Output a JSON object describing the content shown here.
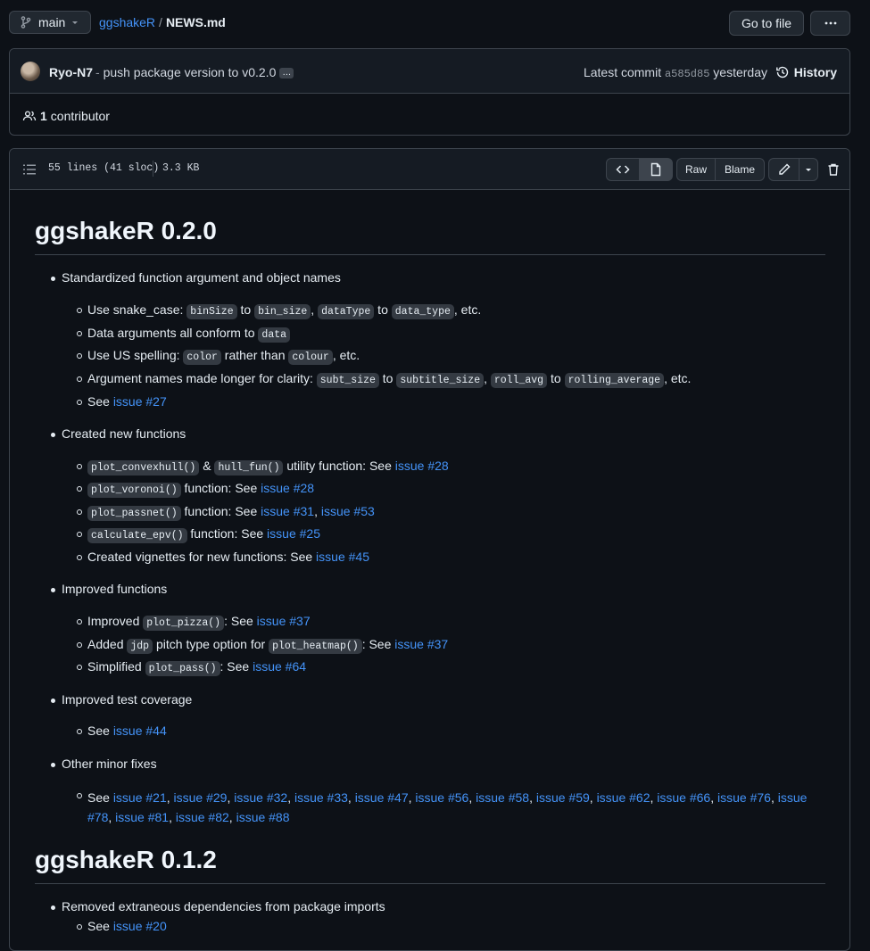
{
  "topbar": {
    "branch": "main",
    "repo": "ggshakeR",
    "separator": "/",
    "file": "NEWS.md",
    "go_to_file": "Go to file"
  },
  "commit": {
    "author": "Ryo-N7",
    "message_prefix": "-",
    "message": "push package version to v0.2.0",
    "ellipsis": "…",
    "latest_label": "Latest commit",
    "sha": "a585d85",
    "when": "yesterday",
    "history": "History",
    "contributors_count": "1",
    "contributors_label": "contributor"
  },
  "file": {
    "lines": "55 lines (41 sloc)",
    "size": "3.3 KB",
    "raw": "Raw",
    "blame": "Blame"
  },
  "doc": {
    "h1_a": "ggshakeR 0.2.0",
    "s1": {
      "title": "Standardized function argument and object names",
      "i1": {
        "t1": "Use snake_case: ",
        "c1": "binSize",
        "t2": " to ",
        "c2": "bin_size",
        "t3": ", ",
        "c3": "dataType",
        "t4": " to ",
        "c4": "data_type",
        "t5": ", etc."
      },
      "i2": {
        "t1": "Data arguments all conform to ",
        "c1": "data"
      },
      "i3": {
        "t1": "Use US spelling: ",
        "c1": "color",
        "t2": " rather than ",
        "c2": "colour",
        "t3": ", etc."
      },
      "i4": {
        "t1": "Argument names made longer for clarity: ",
        "c1": "subt_size",
        "t2": " to ",
        "c2": "subtitle_size",
        "t3": ", ",
        "c3": "roll_avg",
        "t4": " to ",
        "c4": "rolling_average",
        "t5": ", etc."
      },
      "i5": {
        "t1": "See ",
        "l1": "issue #27"
      }
    },
    "s2": {
      "title": "Created new functions",
      "i1": {
        "c1": "plot_convexhull()",
        "t1": " & ",
        "c2": "hull_fun()",
        "t2": " utility function: See ",
        "l1": "issue #28"
      },
      "i2": {
        "c1": "plot_voronoi()",
        "t1": " function: See ",
        "l1": "issue #28"
      },
      "i3": {
        "c1": "plot_passnet()",
        "t1": " function: See ",
        "l1": "issue #31",
        "t2": ", ",
        "l2": "issue #53"
      },
      "i4": {
        "c1": "calculate_epv()",
        "t1": " function: See ",
        "l1": "issue #25"
      },
      "i5": {
        "t1": "Created vignettes for new functions: See ",
        "l1": "issue #45"
      }
    },
    "s3": {
      "title": "Improved functions",
      "i1": {
        "t1": "Improved ",
        "c1": "plot_pizza()",
        "t2": ": See ",
        "l1": "issue #37"
      },
      "i2": {
        "t1": "Added ",
        "c1": "jdp",
        "t2": " pitch type option for ",
        "c2": "plot_heatmap()",
        "t3": ": See ",
        "l1": "issue #37"
      },
      "i3": {
        "t1": "Simplified ",
        "c1": "plot_pass()",
        "t2": ": See ",
        "l1": "issue #64"
      }
    },
    "s4": {
      "title": "Improved test coverage",
      "i1": {
        "t1": "See ",
        "l1": "issue #44"
      }
    },
    "s5": {
      "title": "Other minor fixes",
      "see": "See ",
      "issues": [
        "issue #21",
        "issue #29",
        "issue #32",
        "issue #33",
        "issue #47",
        "issue #56",
        "issue #58",
        "issue #59",
        "issue #62",
        "issue #66",
        "issue #76",
        "issue #78",
        "issue #81",
        "issue #82",
        "issue #88"
      ]
    },
    "h1_b": "ggshakeR 0.1.2",
    "s6": {
      "title": "Removed extraneous dependencies from package imports",
      "i1": {
        "t1": "See ",
        "l1": "issue #20"
      }
    }
  },
  "colors": {
    "bg": "#0d1117",
    "link": "#4493f8",
    "border": "#3d444d"
  }
}
